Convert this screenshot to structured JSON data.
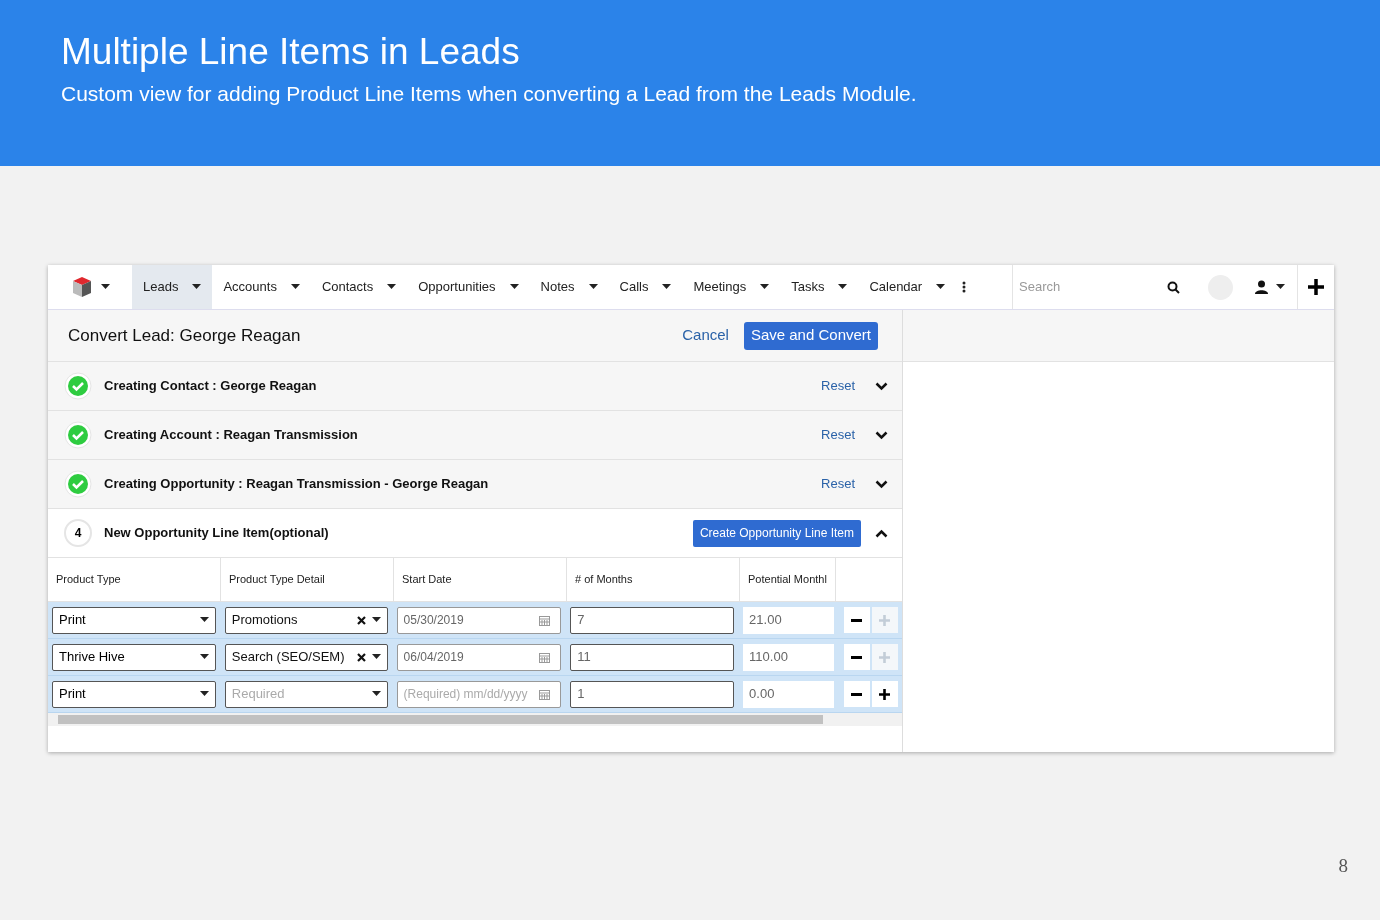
{
  "slide": {
    "title": "Multiple Line Items in Leads",
    "subtitle": "Custom view for adding Product Line Items when converting a Lead from the Leads Module.",
    "page_number": "8"
  },
  "nav": {
    "items": [
      {
        "label": "Leads",
        "selected": true
      },
      {
        "label": "Accounts",
        "selected": false
      },
      {
        "label": "Contacts",
        "selected": false
      },
      {
        "label": "Opportunities",
        "selected": false
      },
      {
        "label": "Notes",
        "selected": false
      },
      {
        "label": "Calls",
        "selected": false
      },
      {
        "label": "Meetings",
        "selected": false
      },
      {
        "label": "Tasks",
        "selected": false
      },
      {
        "label": "Calendar",
        "selected": false
      }
    ],
    "search": {
      "placeholder": "Search"
    }
  },
  "header": {
    "title": "Convert Lead: George Reagan",
    "cancel": "Cancel",
    "save": "Save and Convert"
  },
  "steps": [
    {
      "title": "Creating Contact : George Reagan",
      "done": true,
      "expanded": false,
      "action": "Reset"
    },
    {
      "title": "Creating Account : Reagan Transmission",
      "done": true,
      "expanded": false,
      "action": "Reset"
    },
    {
      "title": "Creating Opportunity : Reagan Transmission - George Reagan",
      "done": true,
      "expanded": false,
      "action": "Reset"
    },
    {
      "marker": "4",
      "title": "New Opportunity Line Item(optional)",
      "done": false,
      "expanded": true,
      "action": "Create Opportunity Line Item"
    }
  ],
  "table": {
    "columns": [
      "Product Type",
      "Product Type Detail",
      "Start Date",
      "# of Months",
      "Potential Monthl"
    ],
    "rows": [
      {
        "product_type": "Print",
        "detail": {
          "value": "Promotions",
          "clearable": true
        },
        "start_date": {
          "value": "05/30/2019"
        },
        "months": "7",
        "potential": "21.00",
        "add_disabled": true
      },
      {
        "product_type": "Thrive Hive",
        "detail": {
          "value": "Search (SEO/SEM)",
          "clearable": true
        },
        "start_date": {
          "value": "06/04/2019"
        },
        "months": "11",
        "potential": "110.00",
        "add_disabled": true
      },
      {
        "product_type": "Print",
        "detail": {
          "placeholder": "Required",
          "clearable": false
        },
        "start_date": {
          "placeholder": "(Required) mm/dd/yyyy"
        },
        "months": "1",
        "potential": "0.00",
        "add_disabled": false
      }
    ]
  }
}
